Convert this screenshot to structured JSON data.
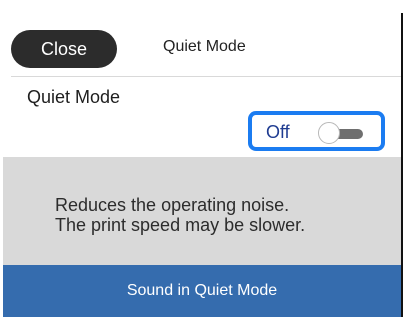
{
  "header": {
    "close_label": "Close",
    "title": "Quiet Mode"
  },
  "setting": {
    "label": "Quiet Mode",
    "toggle_text": "Off"
  },
  "description": {
    "line1": "Reduces the operating noise.",
    "line2": "The print speed may be slower."
  },
  "footer": {
    "button_label": "Sound in Quiet Mode"
  },
  "colors": {
    "close_button_bg": "#2c2c2c",
    "toggle_focus_border": "#1b7cf1",
    "description_panel_bg": "#d9d9d9",
    "footer_button_bg": "#356cae"
  }
}
